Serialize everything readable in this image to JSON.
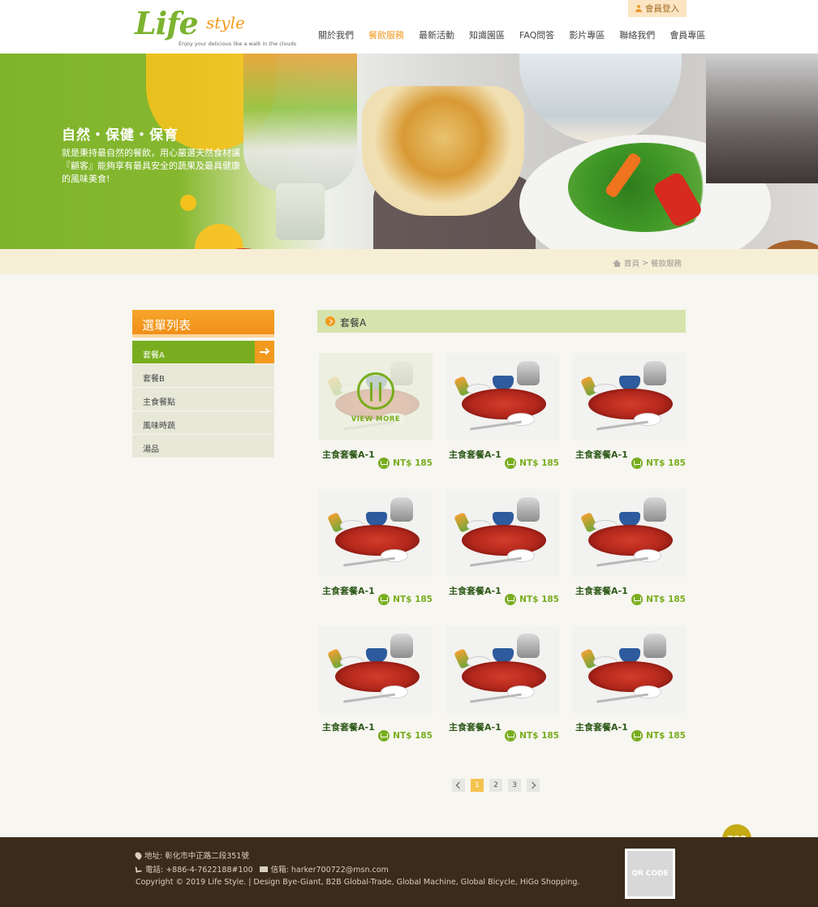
{
  "brand": {
    "logo_main": "Life",
    "logo_sub": "style",
    "tagline": "Enjoy your delicious like a walk in the clouds"
  },
  "member_login": "會員登入",
  "nav": [
    {
      "label": "關於我們",
      "active": false
    },
    {
      "label": "餐飲服務",
      "active": true
    },
    {
      "label": "最新活動",
      "active": false
    },
    {
      "label": "知識園區",
      "active": false
    },
    {
      "label": "FAQ問答",
      "active": false
    },
    {
      "label": "影片專區",
      "active": false
    },
    {
      "label": "聯絡我們",
      "active": false
    },
    {
      "label": "會員專區",
      "active": false
    }
  ],
  "banner": {
    "title": "自然・保健・保育",
    "text": "就是秉持最自然的餐飲，用心嚴選天然食材讓『顧客』能夠享有最具安全的蔬果及最具健康的風味美食!"
  },
  "breadcrumb": {
    "home": "首頁",
    "separator": ">",
    "current": "餐飲服務"
  },
  "sidebar": {
    "title": "選單列表",
    "items": [
      {
        "label": "套餐A",
        "active": true
      },
      {
        "label": "套餐B",
        "active": false
      },
      {
        "label": "主食餐點",
        "active": false
      },
      {
        "label": "風味時蔬",
        "active": false
      },
      {
        "label": "湯品",
        "active": false
      }
    ]
  },
  "section": {
    "title": "套餐A"
  },
  "view_more": "VIEW MORE",
  "products": [
    {
      "name": "主食套餐A-1",
      "price": "NT$ 185"
    },
    {
      "name": "主食套餐A-1",
      "price": "NT$ 185"
    },
    {
      "name": "主食套餐A-1",
      "price": "NT$ 185"
    },
    {
      "name": "主食套餐A-1",
      "price": "NT$ 185"
    },
    {
      "name": "主食套餐A-1",
      "price": "NT$ 185"
    },
    {
      "name": "主食套餐A-1",
      "price": "NT$ 185"
    },
    {
      "name": "主食套餐A-1",
      "price": "NT$ 185"
    },
    {
      "name": "主食套餐A-1",
      "price": "NT$ 185"
    },
    {
      "name": "主食套餐A-1",
      "price": "NT$ 185"
    }
  ],
  "pagination": {
    "pages": [
      "1",
      "2",
      "3"
    ],
    "current": "1"
  },
  "footer": {
    "address": "地址: 彰化市中正路二段351號",
    "phone": "電話: +886-4-7622188#100",
    "email": "信箱: harker700722@msn.com",
    "copyright": "Copyright © 2019 Life Style. | Design Bye-Giant, B2B Global-Trade, Global Machine, Global Bicycle, HiGo Shopping.",
    "qr_label": "QR CODE",
    "top_label": "TOP"
  },
  "colors": {
    "brand_green": "#79ad1f",
    "brand_orange": "#f29a1d",
    "footer_bg": "#3a2b1b"
  }
}
